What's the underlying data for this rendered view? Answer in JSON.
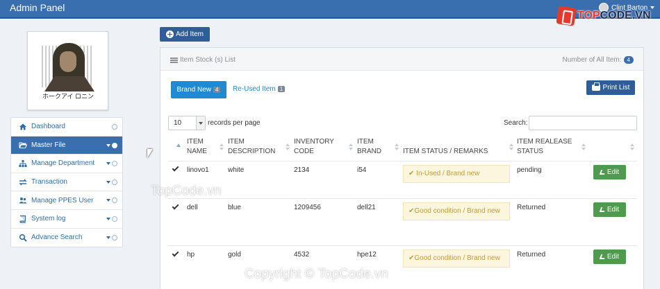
{
  "header": {
    "brand": "Admin Panel",
    "user_name": "Clint Barton"
  },
  "watermark": {
    "logo_text_a": "TOP",
    "logo_text_b": "CODE.VN",
    "mid_text": "TopCode.vn",
    "bottom_text": "Copyright © TopCode.vn"
  },
  "profile": {
    "caption": "ホークアイ ロニン"
  },
  "sidebar": {
    "items": [
      {
        "label": "Dashboard",
        "icon": "home-icon",
        "active": false
      },
      {
        "label": "Master File",
        "icon": "folder-open-icon",
        "active": true
      },
      {
        "label": "Manage Department",
        "icon": "sitemap-icon",
        "active": false
      },
      {
        "label": "Transaction",
        "icon": "exchange-icon",
        "active": false
      },
      {
        "label": "Manage PPES User",
        "icon": "users-icon",
        "active": false
      },
      {
        "label": "System log",
        "icon": "book-icon",
        "active": false
      },
      {
        "label": "Advance Search",
        "icon": "search-icon",
        "active": false
      }
    ]
  },
  "toolbar": {
    "add_label": "Add Item"
  },
  "panel": {
    "title": "Item Stock (s) List",
    "count_label": "Number of All Item:",
    "count_value": "4",
    "tab_new_label": "Brand New",
    "tab_new_count": "4",
    "tab_reused_label": "Re-Used Item",
    "tab_reused_count": "1",
    "print_label": "Print List",
    "length_value": "10",
    "length_label": "records per page",
    "search_label": "Search:"
  },
  "table": {
    "headers": [
      "ITEM\nNAME",
      "ITEM\nDESCRIPTION",
      "INVENTORY\nCODE",
      "ITEM\nBRAND",
      "ITEM STATUS / REMARKS",
      "ITEM REALEASE\nSTATUS"
    ],
    "edit_label": "Edit",
    "rows": [
      {
        "name": "linovo1",
        "description": "white",
        "code": "2134",
        "brand": "i54",
        "status": "In-Used / Brand new",
        "release": "pending"
      },
      {
        "name": "dell",
        "description": "blue",
        "code": "1209456",
        "brand": "dell21",
        "status": "Good condition / Brand new",
        "release": "Returned"
      },
      {
        "name": "hp",
        "description": "gold",
        "code": "4532",
        "brand": "hpe12",
        "status": "Good condition / Brand new",
        "release": "Returned"
      }
    ]
  },
  "colors": {
    "navbar": "#3a6faf",
    "primary_button": "#2f5d97",
    "tab_active": "#1f8ad3",
    "edit_button": "#4f9a4f",
    "status_bg": "#fcf6de"
  }
}
